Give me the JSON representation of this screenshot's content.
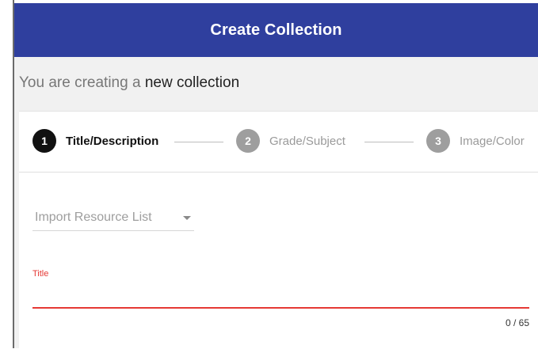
{
  "header": {
    "title": "Create Collection"
  },
  "subtitle": {
    "prefix": "You are creating a",
    "emphasis": "new collection"
  },
  "stepper": {
    "steps": [
      {
        "number": "1",
        "label": "Title/Description",
        "state": "active"
      },
      {
        "number": "2",
        "label": "Grade/Subject",
        "state": "inactive"
      },
      {
        "number": "3",
        "label": "Image/Color",
        "state": "inactive"
      }
    ]
  },
  "import": {
    "label": "Import Resource List"
  },
  "title_field": {
    "label": "Title",
    "value": "",
    "counter": "0 / 65"
  },
  "colors": {
    "header_bg": "#2f3f9e",
    "active_step": "#111111",
    "inactive_step": "#9e9e9e",
    "error_red": "#e53935"
  }
}
